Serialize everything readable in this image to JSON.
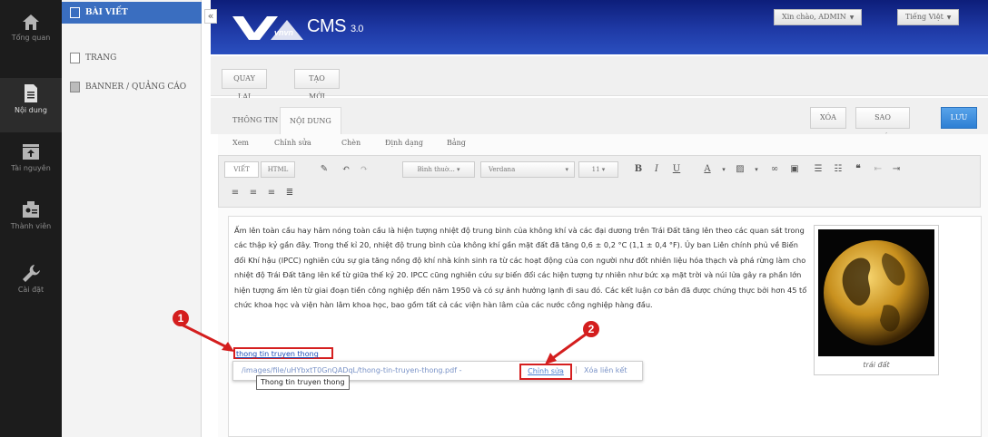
{
  "rail": {
    "items": [
      {
        "label": "Tổng quan",
        "icon": "home-icon"
      },
      {
        "label": "Nội dung",
        "icon": "document-icon"
      },
      {
        "label": "Tài nguyên",
        "icon": "folder-icon"
      },
      {
        "label": "Thành viên",
        "icon": "users-icon"
      },
      {
        "label": "Cài đặt",
        "icon": "wrench-icon"
      }
    ]
  },
  "sidebar": {
    "items": [
      {
        "label": "BÀI VIẾT"
      },
      {
        "label": "TRANG"
      },
      {
        "label": "BANNER / QUẢNG CÁO"
      }
    ]
  },
  "header": {
    "logo_text": "CMS",
    "logo_version": "3.0",
    "logo_sub": "vnvn",
    "greeting": "Xin chào, ADMIN",
    "language": "Tiếng Việt"
  },
  "actions": {
    "back": "QUAY LẠI",
    "new": "TẠO MỚI"
  },
  "tabs": {
    "info": "THÔNG TIN",
    "content": "NỘI DUNG",
    "delete": "XÓA",
    "copy": "SAO CHÉP",
    "save": "LƯU"
  },
  "editor": {
    "menus": [
      "Xem",
      "Chỉnh sửa",
      "Chèn",
      "Định dạng",
      "Bảng"
    ],
    "mode_visual": "VIẾT",
    "mode_html": "HTML",
    "format_select": "Bình thuờ...",
    "font_select": "Verdana",
    "size_select": "11",
    "bold": "B",
    "italic": "I",
    "underline": "U",
    "font_color": "A"
  },
  "content": {
    "paragraph": "Ấm lên toàn cầu hay hâm nóng toàn cầu là hiện tượng nhiệt độ trung bình của không khí và các đại dương trên Trái Đất tăng lên theo các quan sát trong các thập kỷ gần đây. Trong thế kỉ 20, nhiệt độ trung bình của không khí gần mặt đất đã tăng 0,6 ± 0,2 °C (1,1 ± 0,4 °F). Ủy ban Liên chính phủ về Biến đổi Khí hậu (IPCC) nghiên cứu sự gia tăng nồng độ khí nhà kính sinh ra từ các hoạt động của con người như đốt nhiên liệu hóa thạch và phá rừng làm cho nhiệt độ Trái Đất tăng lên kể từ giữa thế kỷ 20. IPCC cũng nghiên cứu sự biến đổi các hiện tượng tự nhiên như bức xạ mặt trời và núi lửa gây ra phần lớn hiện tượng ấm lên từ giai đoạn tiền công nghiệp đến năm 1950 và có sự ảnh hưởng lạnh đi sau đó. Các kết luận cơ bản đã được chứng thực bởi hơn 45 tổ chức khoa học và viện hàn lâm khoa học, bao gồm tất cả các viện hàn lâm của các nước công nghiệp hàng đầu.",
    "link_text": "thong tin truyen thong",
    "image_caption": "trái đất"
  },
  "link_popup": {
    "url": "/images/file/uHYbxtT0GnQADqL/thong-tin-truyen-thong.pdf",
    "dash": "-",
    "edit": "Chỉnh sửa",
    "separator": "|",
    "unlink": "Xóa liên kết",
    "tooltip": "Thong tin truyen thong"
  },
  "markers": [
    "1",
    "2"
  ],
  "colors": {
    "header_blue": "#1f3aa6",
    "active_blue": "#3a6ec0",
    "save_blue": "#2d7fd4",
    "annotation_red": "#d41e1e"
  }
}
